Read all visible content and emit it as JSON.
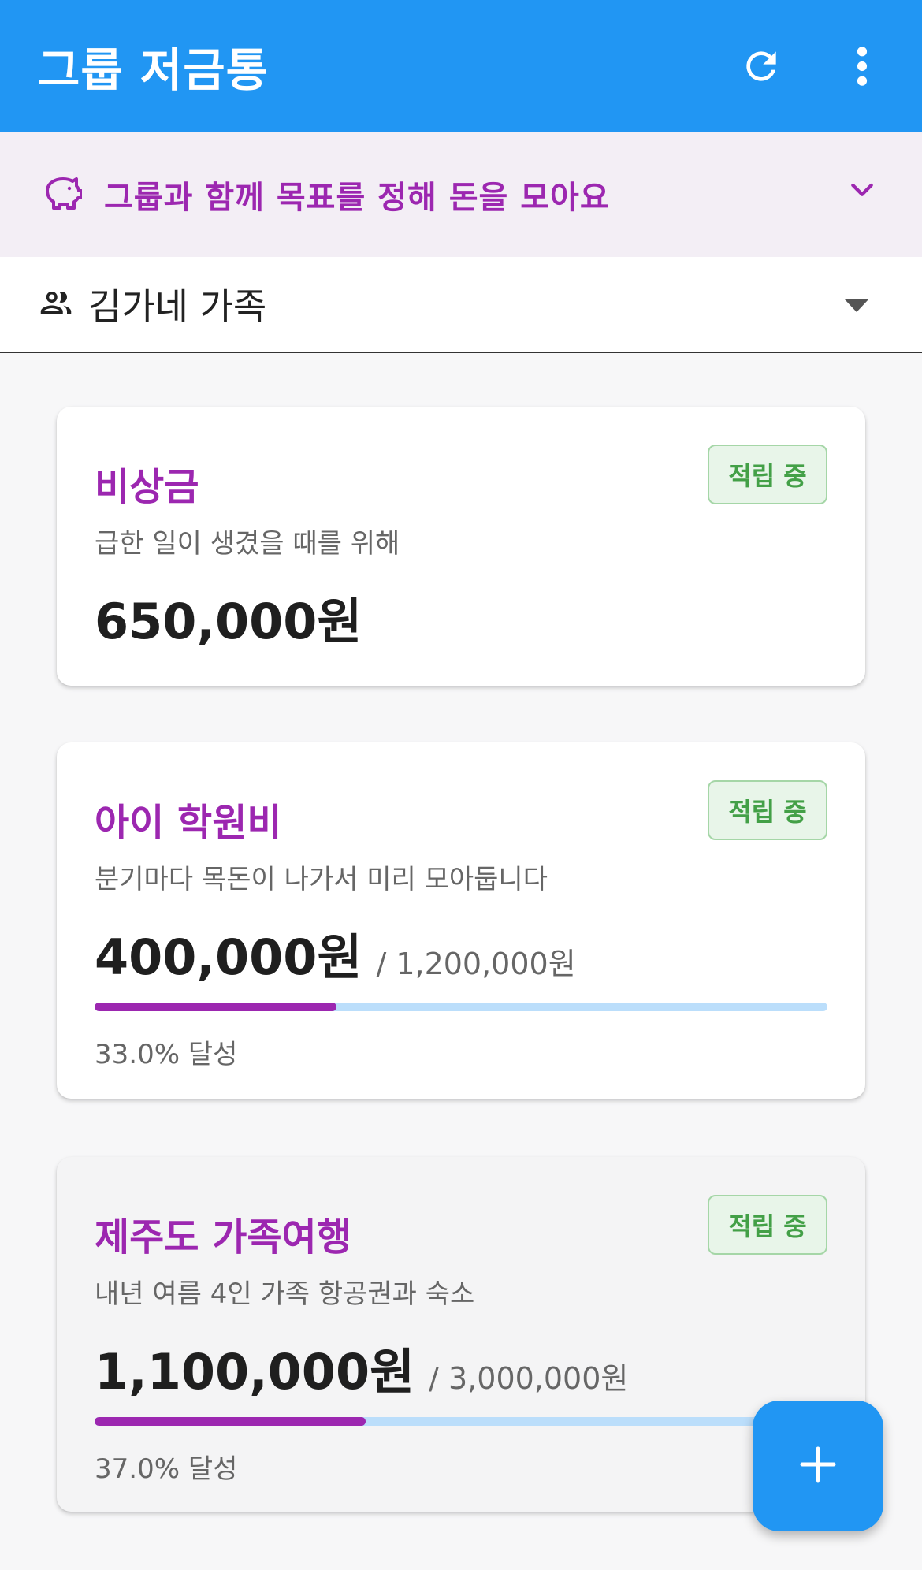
{
  "app": {
    "title": "그룹 저금통"
  },
  "icons": {
    "refresh": "refresh-icon",
    "more": "more-vert-icon",
    "piggy": "piggy-bank-icon",
    "expand": "chevron-down-icon",
    "group": "people-icon",
    "dropdown": "caret-down-icon",
    "add": "plus-icon"
  },
  "colors": {
    "primary": "#2196f3",
    "accent": "#9c27b0",
    "badge_green": "#43a047",
    "progress_track": "#bbdefb"
  },
  "banner": {
    "text": "그룹과 함께 목표를 정해 돈을 모아요"
  },
  "group_selector": {
    "selected": "김가네 가족"
  },
  "goals": [
    {
      "name": "비상금",
      "description": "급한 일이 생겼을 때를 위해",
      "amount": "650,000원",
      "status": "적립 중"
    },
    {
      "name": "아이 학원비",
      "description": "분기마다 목돈이 나가서 미리 모아둡니다",
      "amount": "400,000원",
      "target": "/ 1,200,000원",
      "progress_percent": 33.0,
      "progress_label": "33.0% 달성",
      "status": "적립 중"
    },
    {
      "name": "제주도 가족여행",
      "description": "내년 여름 4인 가족 항공권과 숙소",
      "amount": "1,100,000원",
      "target": "/ 3,000,000원",
      "progress_percent": 37.0,
      "progress_label": "37.0% 달성",
      "status": "적립 중"
    }
  ]
}
